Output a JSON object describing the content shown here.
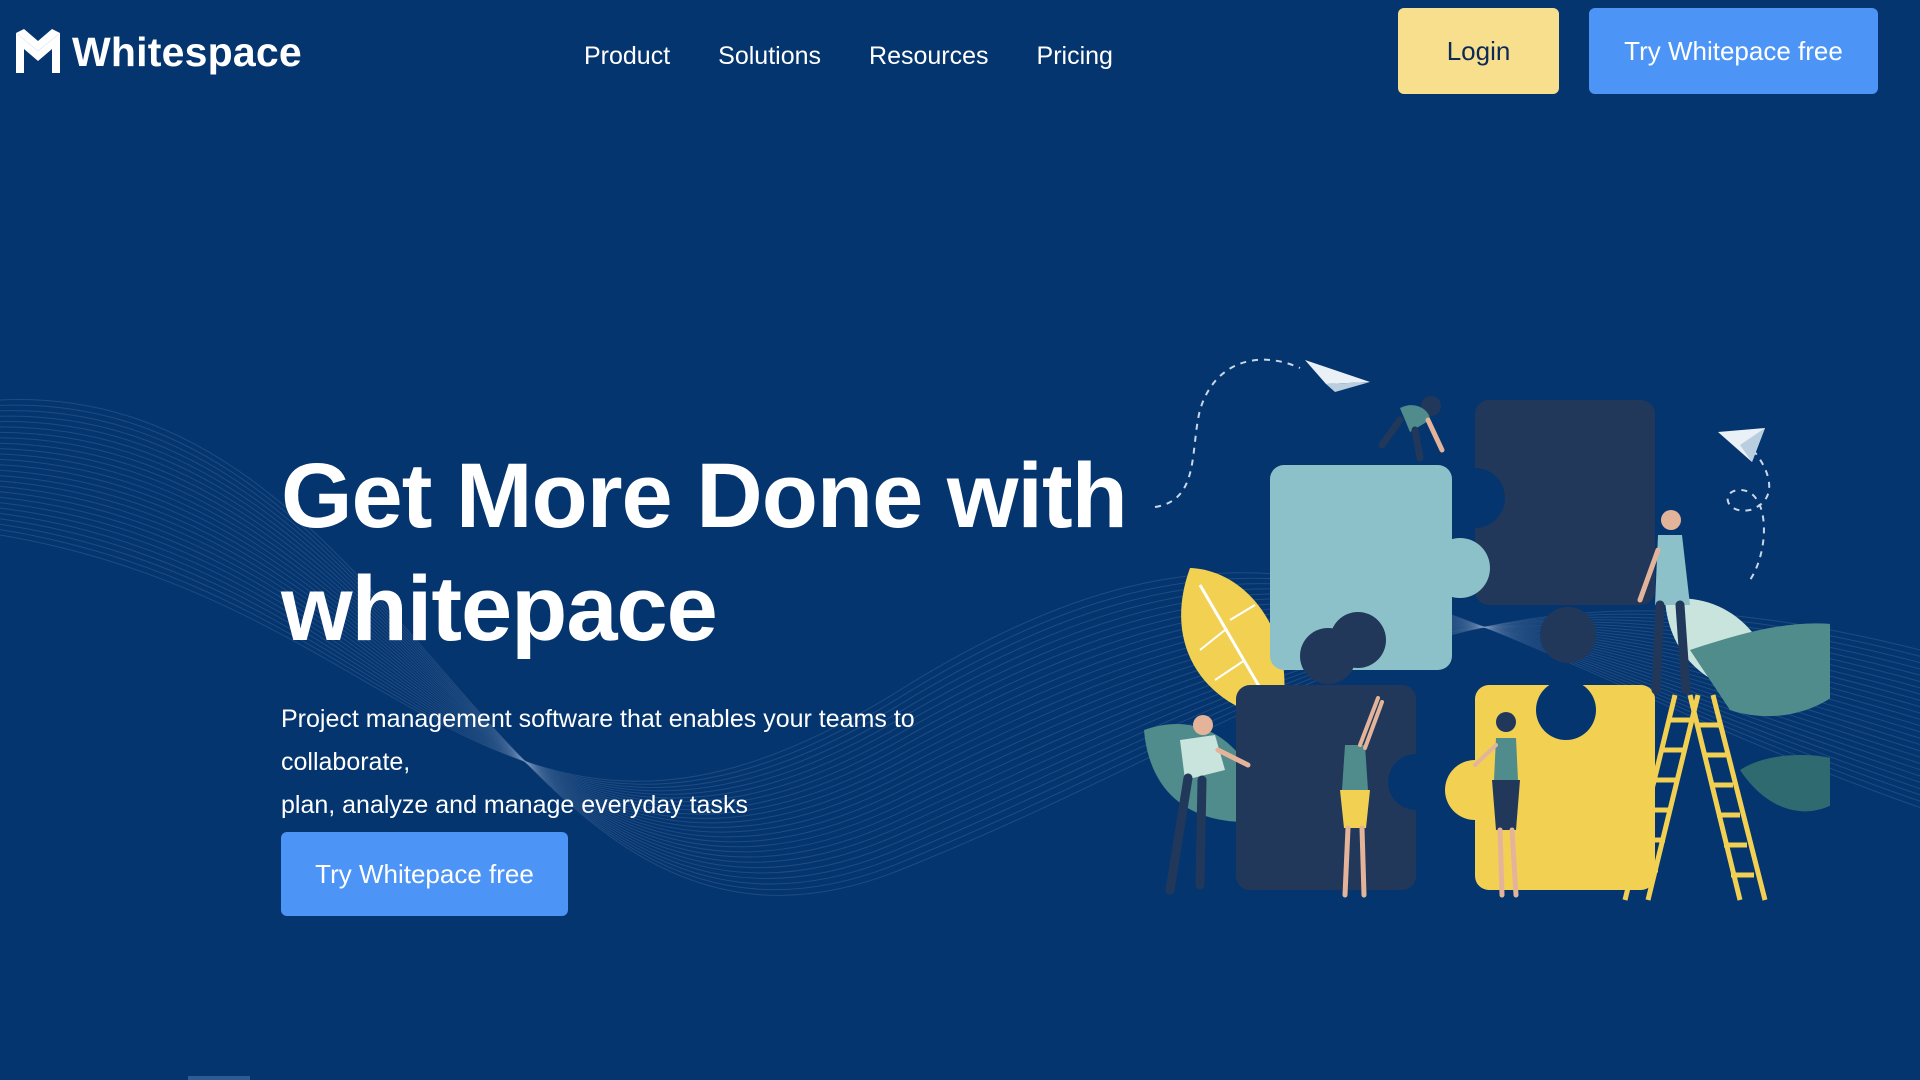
{
  "header": {
    "brand": "Whitespace",
    "nav": [
      {
        "label": "Product"
      },
      {
        "label": "Solutions"
      },
      {
        "label": "Resources"
      },
      {
        "label": "Pricing"
      }
    ],
    "login_label": "Login",
    "cta_label": "Try Whitepace free"
  },
  "hero": {
    "title_line1": "Get More Done with",
    "title_line2": "whitepace",
    "subtitle_line1": "Project management software that enables your teams to collaborate,",
    "subtitle_line2": "plan, analyze and manage everyday tasks",
    "cta_label": "Try Whitepace free"
  },
  "illustration": {
    "icons": [
      "paper-plane-icon",
      "paper-plane-icon",
      "puzzle-piece-icon",
      "person-icon",
      "ladder-icon",
      "leaf-icon"
    ]
  },
  "colors": {
    "background": "#05356f",
    "primary_button": "#4c94f6",
    "login_button": "#f7df8e",
    "puzzle_teal": "#8cc1c9",
    "puzzle_navy": "#21385b",
    "puzzle_yellow": "#f2d052"
  }
}
